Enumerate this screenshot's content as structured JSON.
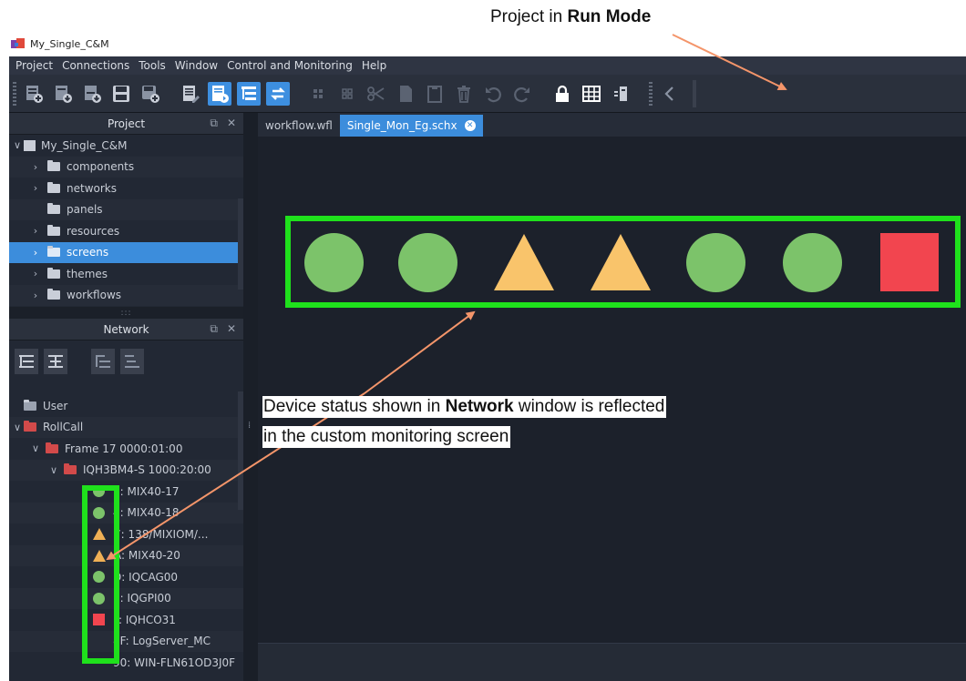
{
  "annotations": {
    "top_pre": "Project in ",
    "top_bold": "Run Mode",
    "middle_pre": "Device status shown in ",
    "middle_bold": "Network",
    "middle_post": " window is reflected",
    "middle_line2": "in the custom monitoring screen",
    "highlight_color": "#1fe11c",
    "arrow_color": "#f4956a"
  },
  "window": {
    "title": "My_Single_C&M"
  },
  "menu": [
    "Project",
    "Connections",
    "Tools",
    "Window",
    "Control and Monitoring",
    "Help"
  ],
  "toolbar": {
    "icons": [
      "new-project-icon",
      "open-project-icon",
      "download-icon",
      "save-icon",
      "save-as-icon",
      "edit-mode-icon",
      "run-mode-icon",
      "tree-icon",
      "swap-icon",
      "grid-small-icon",
      "grid-small-2-icon",
      "cut-icon",
      "copy-icon",
      "paste-icon",
      "delete-icon",
      "undo-icon",
      "redo-icon",
      "lock-icon",
      "table-icon",
      "monitor-icon",
      "back-icon"
    ],
    "active": [
      "run-mode-icon",
      "tree-icon",
      "swap-icon"
    ]
  },
  "project_panel": {
    "title": "Project",
    "root": "My_Single_C&M",
    "items": [
      {
        "label": "components",
        "expandable": true
      },
      {
        "label": "networks",
        "expandable": true
      },
      {
        "label": "panels",
        "expandable": false
      },
      {
        "label": "resources",
        "expandable": true
      },
      {
        "label": "screens",
        "expandable": true,
        "selected": true
      },
      {
        "label": "themes",
        "expandable": true
      },
      {
        "label": "workflows",
        "expandable": true
      }
    ]
  },
  "network_panel": {
    "title": "Network",
    "tree": {
      "user": "User",
      "rollcall": "RollCall",
      "frame": "Frame 17 0000:01:00",
      "device": "IQH3BM4-S 1000:20:00",
      "cards": [
        {
          "label": "1: MIX40-17",
          "status": "ok"
        },
        {
          "label": "4: MIX40-18",
          "status": "ok"
        },
        {
          "label": "7: 138/MIXIOM/...",
          "status": "warn"
        },
        {
          "label": "A: MIX40-20",
          "status": "warn"
        },
        {
          "label": "D: IQCAG00",
          "status": "ok"
        },
        {
          "label": "E: IQGPI00",
          "status": "ok"
        },
        {
          "label": "F: IQHCO31",
          "status": "err"
        }
      ],
      "extra1": "8F: LogServer_MC",
      "extra2": "90: WIN-FLN61OD3J0F"
    }
  },
  "tabs": [
    {
      "label": "workflow.wfl",
      "active": false
    },
    {
      "label": "Single_Mon_Eg.schx",
      "active": true
    }
  ],
  "screen": {
    "shapes": [
      "ok",
      "ok",
      "warn",
      "warn",
      "ok",
      "ok",
      "err"
    ],
    "colors": {
      "ok": "#7cc36a",
      "warn": "#f9c46b",
      "err": "#f2454f"
    }
  }
}
